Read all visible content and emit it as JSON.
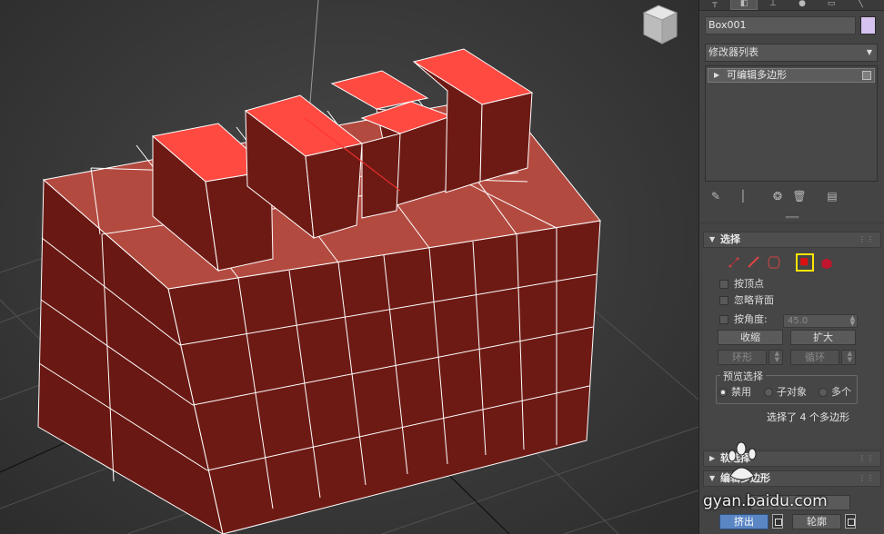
{
  "object": {
    "name": "Box001",
    "color": "#d6c3ef"
  },
  "modifier_list": {
    "label": "修改器列表"
  },
  "modifier_stack": {
    "items": [
      {
        "label": "可编辑多边形"
      }
    ]
  },
  "rollouts": {
    "selection": {
      "title": "选择",
      "checkboxes": [
        {
          "label": "按顶点"
        },
        {
          "label": "忽略背面"
        },
        {
          "label": "按角度:"
        }
      ],
      "angle_value": "45.0",
      "shrink_label": "收缩",
      "grow_label": "扩大",
      "ring_label": "环形",
      "loop_label": "循环",
      "preview": {
        "title": "预览选择",
        "options": [
          "禁用",
          "子对象",
          "多个"
        ],
        "selected": 0
      },
      "status": "选择了 4 个多边形"
    },
    "soft_selection": {
      "title": "软选择"
    },
    "edit_polygons": {
      "title": "编辑多边形"
    }
  },
  "bottom_buttons": {
    "extrude_label": "挤出",
    "outline_label": "轮廓"
  },
  "watermark": {
    "text": "gyan.baidu.com"
  },
  "colors": {
    "selected_face": "#ff4a42",
    "face_dark": "#6e1a14",
    "face_top": "#b34a40",
    "accent_blue": "#5a86c4",
    "highlight": "#ffe600"
  }
}
